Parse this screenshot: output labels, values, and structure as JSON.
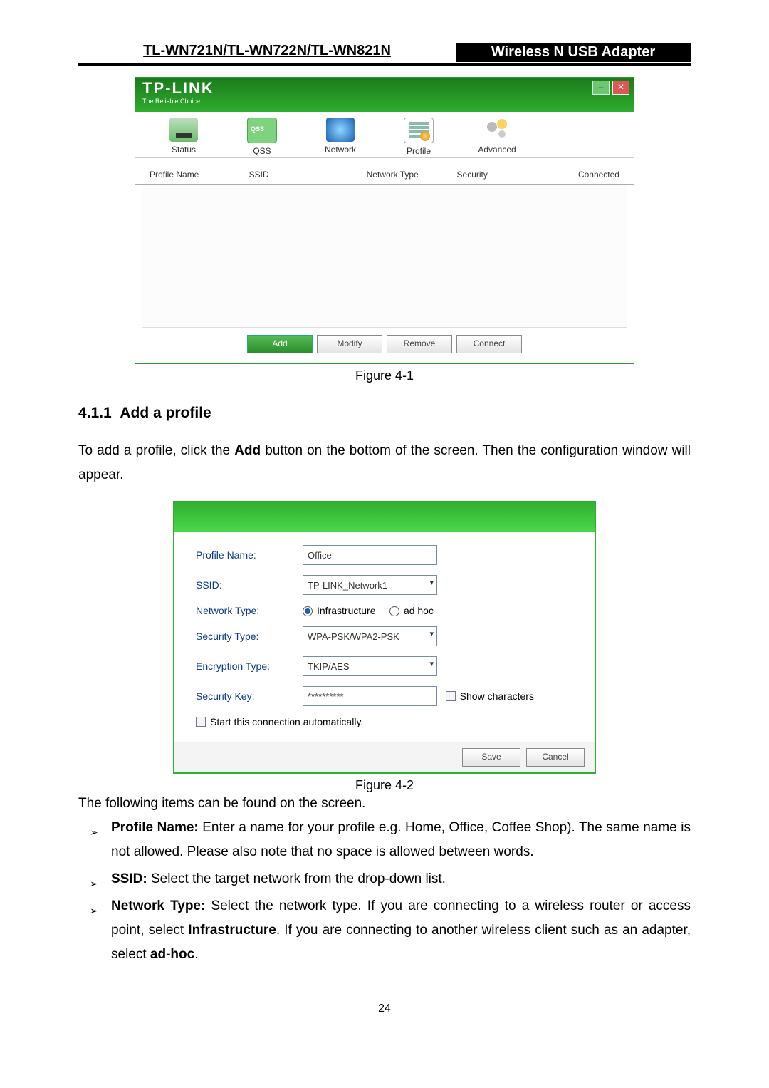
{
  "header": {
    "left": "TL-WN721N/TL-WN722N/TL-WN821N",
    "right": "Wireless N USB Adapter"
  },
  "fig1": {
    "brand": "TP-LINK",
    "brand_sub": "The Reliable Choice",
    "tabs": {
      "status": "Status",
      "qss": "QSS",
      "network": "Network",
      "profile": "Profile",
      "advanced": "Advanced"
    },
    "columns": {
      "c1": "Profile Name",
      "c2": "SSID",
      "c3": "Network Type",
      "c4": "Security",
      "c5": "Connected"
    },
    "buttons": {
      "add": "Add",
      "modify": "Modify",
      "remove": "Remove",
      "connect": "Connect"
    },
    "caption": "Figure 4-1"
  },
  "section": {
    "num_title": "4.1.1  Add a profile",
    "para_pre": "To add a profile, click the ",
    "para_bold": "Add",
    "para_post": " button on the bottom of the screen. Then the configuration window will appear."
  },
  "fig2": {
    "labels": {
      "profile": "Profile Name:",
      "ssid": "SSID:",
      "ntype": "Network Type:",
      "stype": "Security Type:",
      "enc": "Encryption Type:",
      "skey": "Security Key:"
    },
    "values": {
      "profile": "Office",
      "ssid": "TP-LINK_Network1",
      "infra": "Infrastructure",
      "adhoc": "ad hoc",
      "stype": "WPA-PSK/WPA2-PSK",
      "enc": "TKIP/AES",
      "skey": "**********",
      "showchars": "Show characters",
      "autoconn": "Start this connection automatically."
    },
    "buttons": {
      "save": "Save",
      "cancel": "Cancel"
    },
    "caption": "Figure 4-2"
  },
  "following": "The following items can be found on the screen.",
  "bullets": {
    "b1": {
      "t": "Profile Name:",
      "rest": " Enter a name for your profile e.g. Home, Office, Coffee Shop). The same name is not allowed. Please also note that no space is allowed between words."
    },
    "b2": {
      "t": "SSID:",
      "rest": " Select the target network from the drop-down list."
    },
    "b3": {
      "t": "Network Type:",
      "p1": " Select the network type. If you are connecting to a wireless router or access point, select ",
      "s1": "Infrastructure",
      "p2": ". If you are connecting to another wireless client such as an adapter, select ",
      "s2": "ad-hoc",
      "p3": "."
    }
  },
  "page_number": "24"
}
